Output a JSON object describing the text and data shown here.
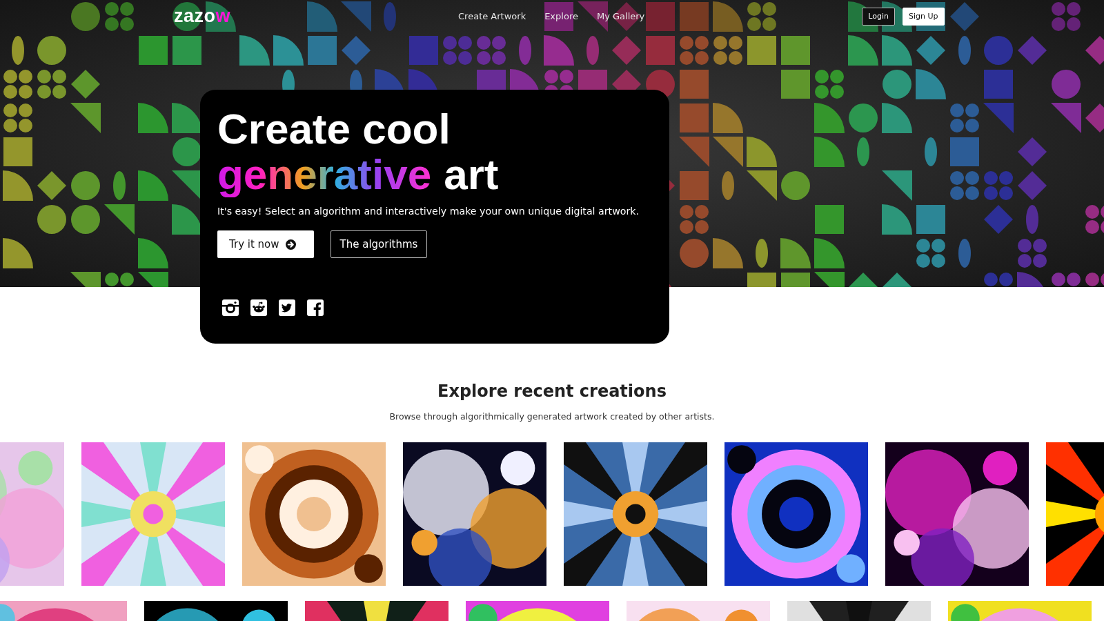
{
  "header": {
    "logo": {
      "main": "zazo",
      "accent": "w"
    },
    "nav": [
      "Create Artwork",
      "Explore",
      "My Gallery"
    ],
    "login": "Login",
    "signup": "Sign Up"
  },
  "hero": {
    "title_line": "Create cool",
    "title_accent": "generative",
    "title_rest": "art",
    "subtitle": "It's easy! Select an algorithm and interactively make your own unique digital artwork.",
    "primary_button": "Try it now",
    "secondary_button": "The algorithms"
  },
  "section": {
    "title": "Explore recent creations",
    "subtitle": "Browse through algorithmically generated artwork created by other artists."
  }
}
